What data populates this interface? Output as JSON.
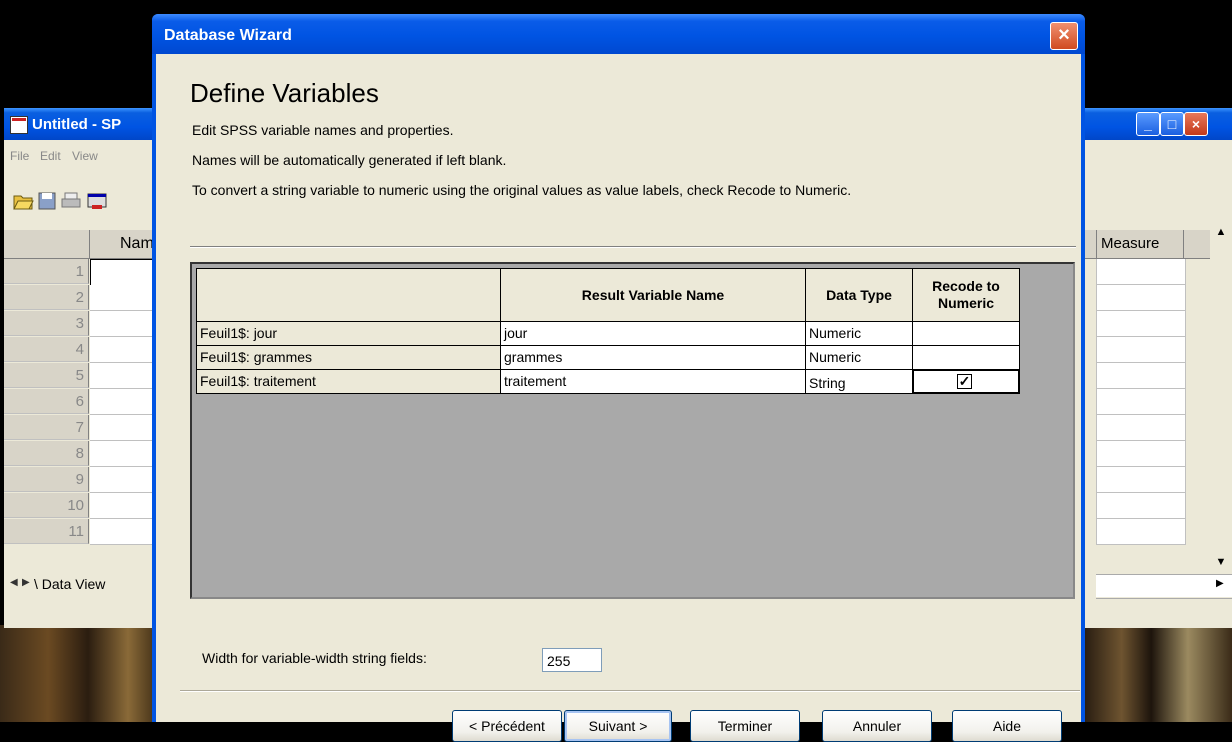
{
  "background_window": {
    "title": "Untitled - SP",
    "menu": [
      "File",
      "Edit",
      "View"
    ],
    "grid_column_header": "Nam",
    "grid_right_header": "Measure",
    "row_numbers": [
      "1",
      "2",
      "3",
      "4",
      "5",
      "6",
      "7",
      "8",
      "9",
      "10",
      "11"
    ],
    "tab_label": "Data View"
  },
  "dialog": {
    "title": "Database Wizard",
    "heading": "Define Variables",
    "descriptions": [
      "Edit SPSS variable names and properties.",
      "Names will be automatically generated if left blank.",
      "To convert a string variable to numeric using the original values as value labels, check Recode to Numeric."
    ],
    "table": {
      "headers": [
        "",
        "Result Variable Name",
        "Data Type",
        "Recode to Numeric"
      ],
      "rows": [
        {
          "source": "Feuil1$: jour",
          "name": "jour",
          "type": "Numeric",
          "recode": false,
          "recode_visible": false
        },
        {
          "source": "Feuil1$: grammes",
          "name": "grammes",
          "type": "Numeric",
          "recode": false,
          "recode_visible": false
        },
        {
          "source": "Feuil1$: traitement",
          "name": "traitement",
          "type": "String",
          "recode": true,
          "recode_visible": true
        }
      ]
    },
    "width_label": "Width for variable-width string fields:",
    "width_value": "255",
    "buttons": {
      "previous": "< Précédent",
      "next": "Suivant >",
      "finish": "Terminer",
      "cancel": "Annuler",
      "help": "Aide"
    }
  }
}
